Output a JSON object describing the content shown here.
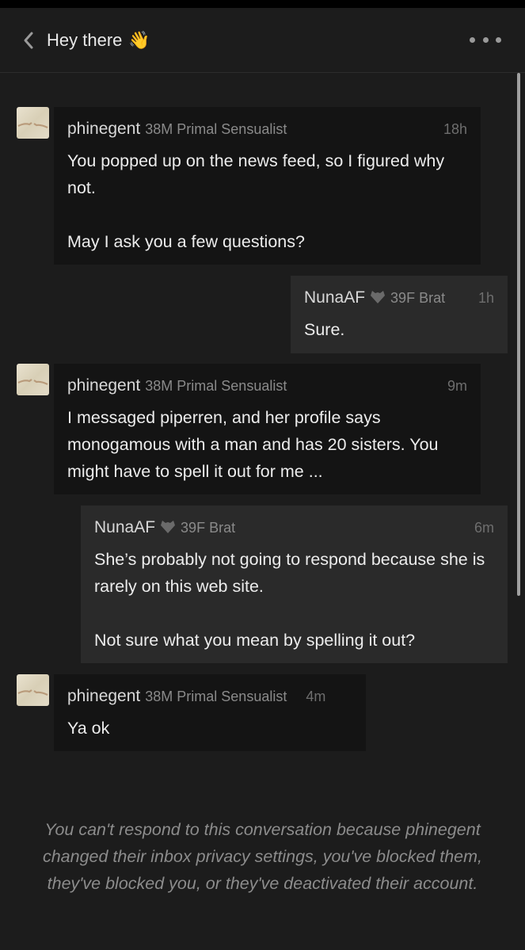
{
  "header": {
    "title": "Hey there",
    "title_emoji": "👋",
    "back_icon": "chevron-left-icon",
    "more_icon": "more-horizontal-icon"
  },
  "messages": [
    {
      "sender": "phinegent",
      "details": "38M Primal Sensualist",
      "time": "18h",
      "text": "You popped up on the news feed, so I figured why not.\n\nMay I ask you a few questions?",
      "from_me": false
    },
    {
      "sender": "NunaAF",
      "details": "39F Brat",
      "time": "1h",
      "text": "Sure.",
      "from_me": true
    },
    {
      "sender": "phinegent",
      "details": "38M Primal Sensualist",
      "time": "9m",
      "text": "I messaged piperren, and her profile says monogamous with a man and has 20 sisters. You might have to spell it out for me ...",
      "from_me": false
    },
    {
      "sender": "NunaAF",
      "details": "39F Brat",
      "time": "6m",
      "text": "She’s probably not going to respond because she is rarely on this web site.\n\nNot sure what you mean by spelling it out?",
      "from_me": true
    },
    {
      "sender": "phinegent",
      "details": "38M Primal Sensualist",
      "time": "4m",
      "text": "Ya ok",
      "from_me": false
    }
  ],
  "notice": "You can't respond to this conversation because phinegent changed their inbox privacy settings, you've blocked them, they've blocked you, or they've deactivated their account.",
  "colors": {
    "background": "#1c1c1c",
    "their_bubble": "#141414",
    "my_bubble": "#2a2a2a",
    "heart_icon": "#6a6a6a"
  }
}
